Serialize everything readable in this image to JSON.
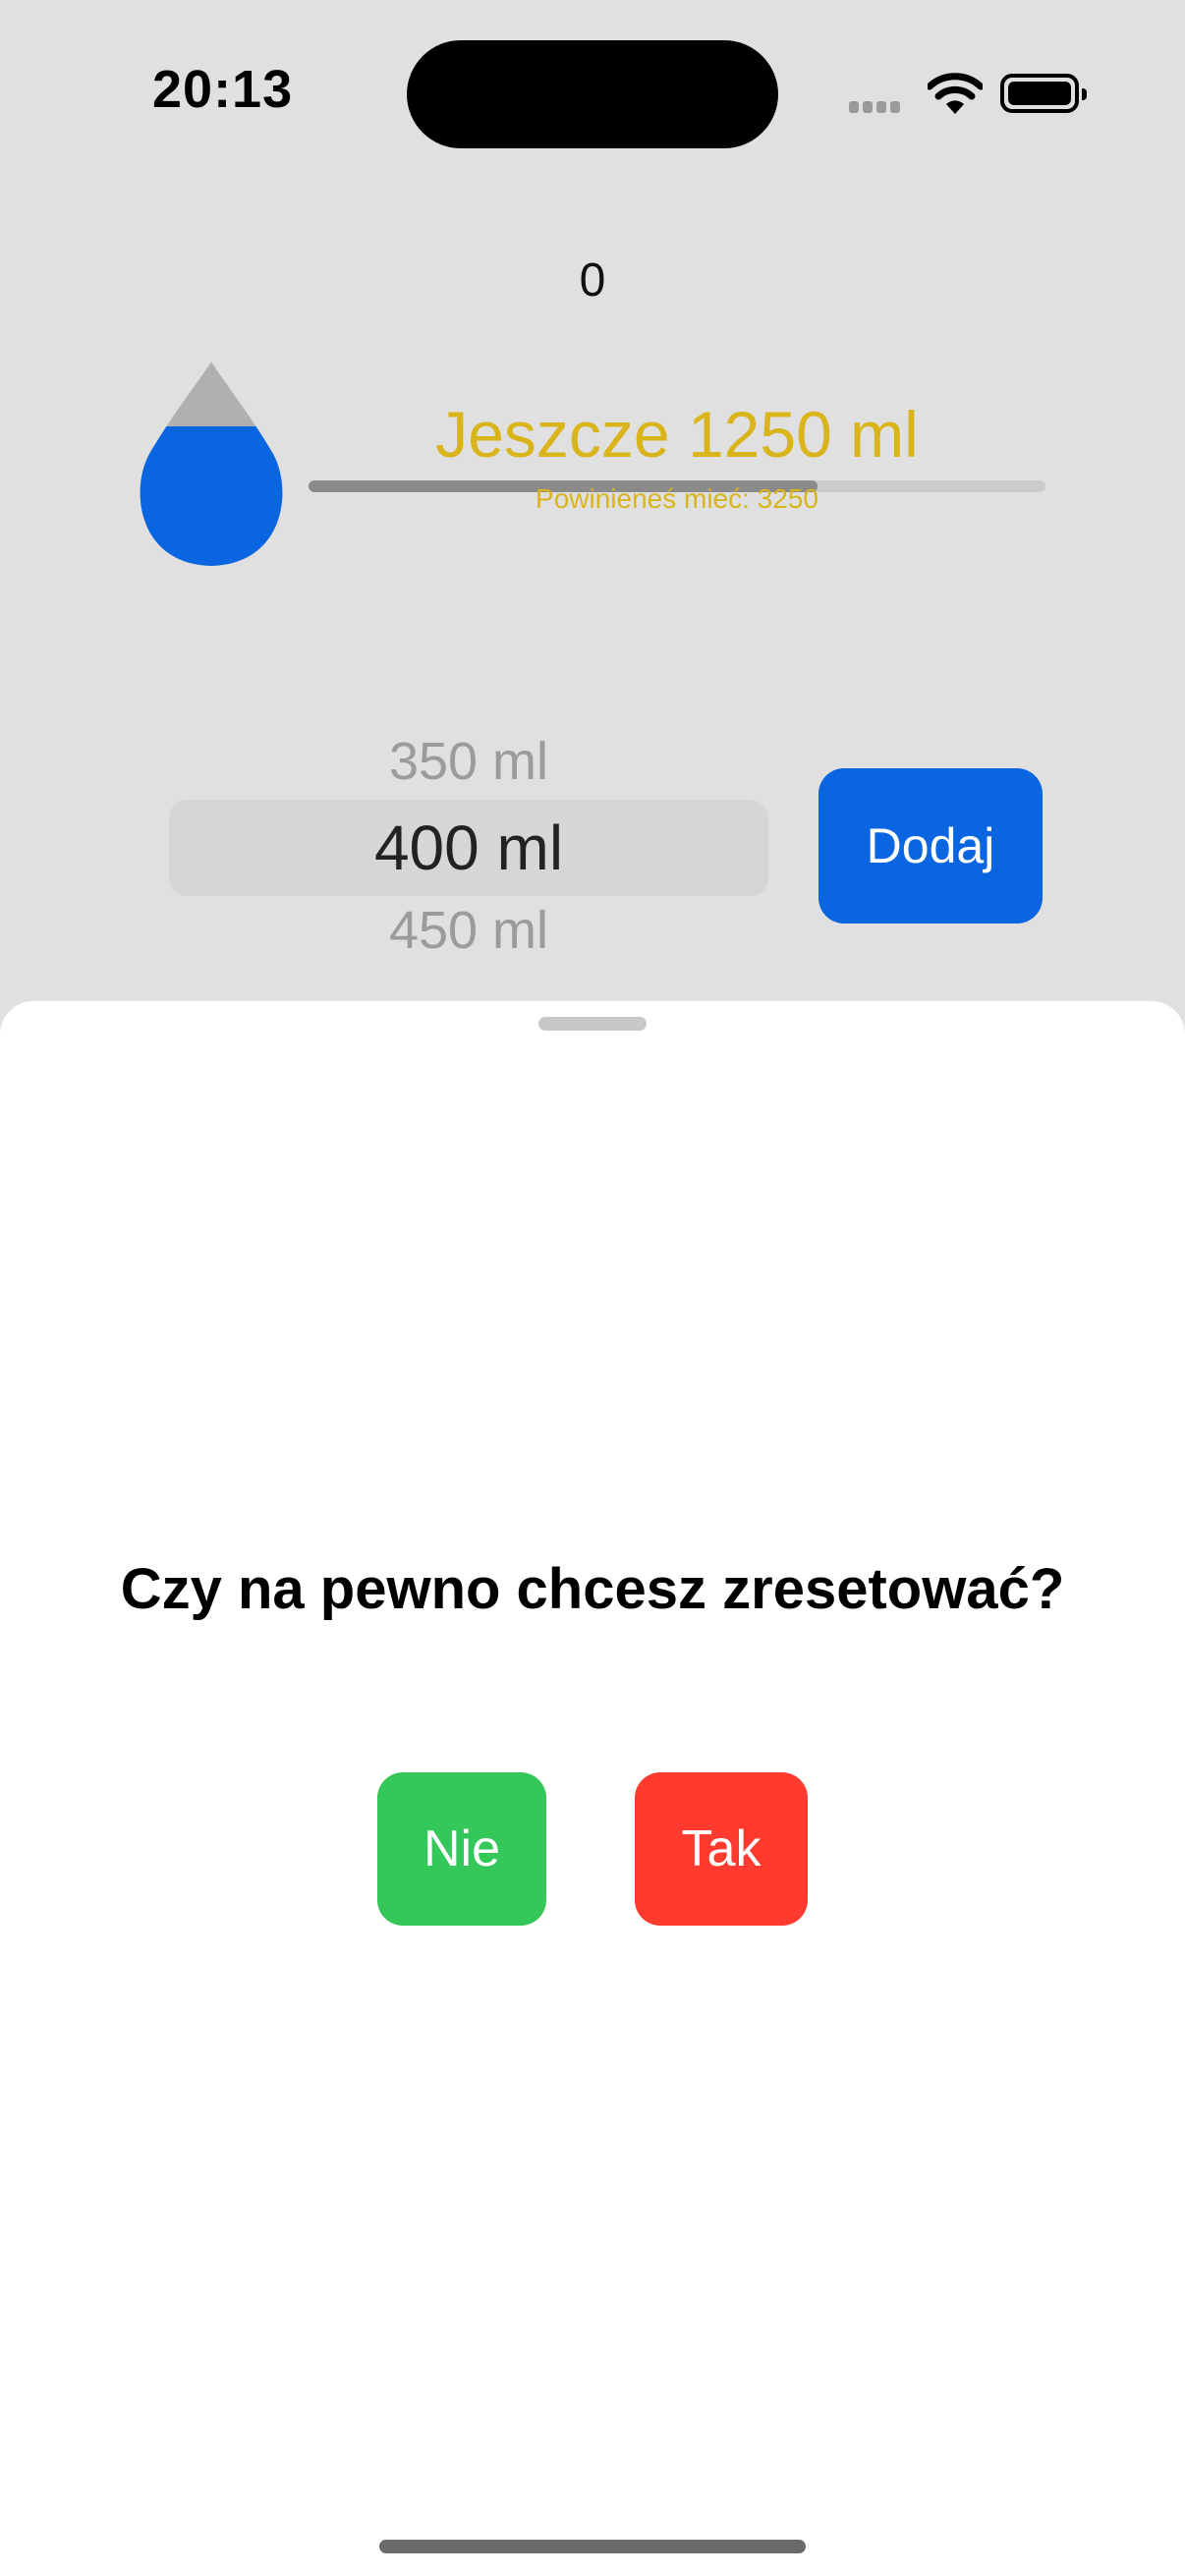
{
  "status_bar": {
    "time": "20:13"
  },
  "tracker": {
    "counter": "0",
    "remaining_label": "Jeszcze 1250 ml",
    "target_label": "Powinieneś mieć: 3250",
    "progress_fraction": 0.69
  },
  "picker": {
    "previous": "350 ml",
    "selected": "400 ml",
    "next": "450 ml"
  },
  "add_button_label": "Dodaj",
  "reset_sheet": {
    "question": "Czy na pewno chcesz zresetować?",
    "no_label": "Nie",
    "yes_label": "Tak"
  },
  "colors": {
    "accent_blue": "#0a66e0",
    "warning_yellow": "#d9b51b",
    "confirm_green": "#34c759",
    "destructive_red": "#ff3b30"
  },
  "icons": [
    "water-drop-icon",
    "signal-icon",
    "wifi-icon",
    "battery-icon"
  ]
}
